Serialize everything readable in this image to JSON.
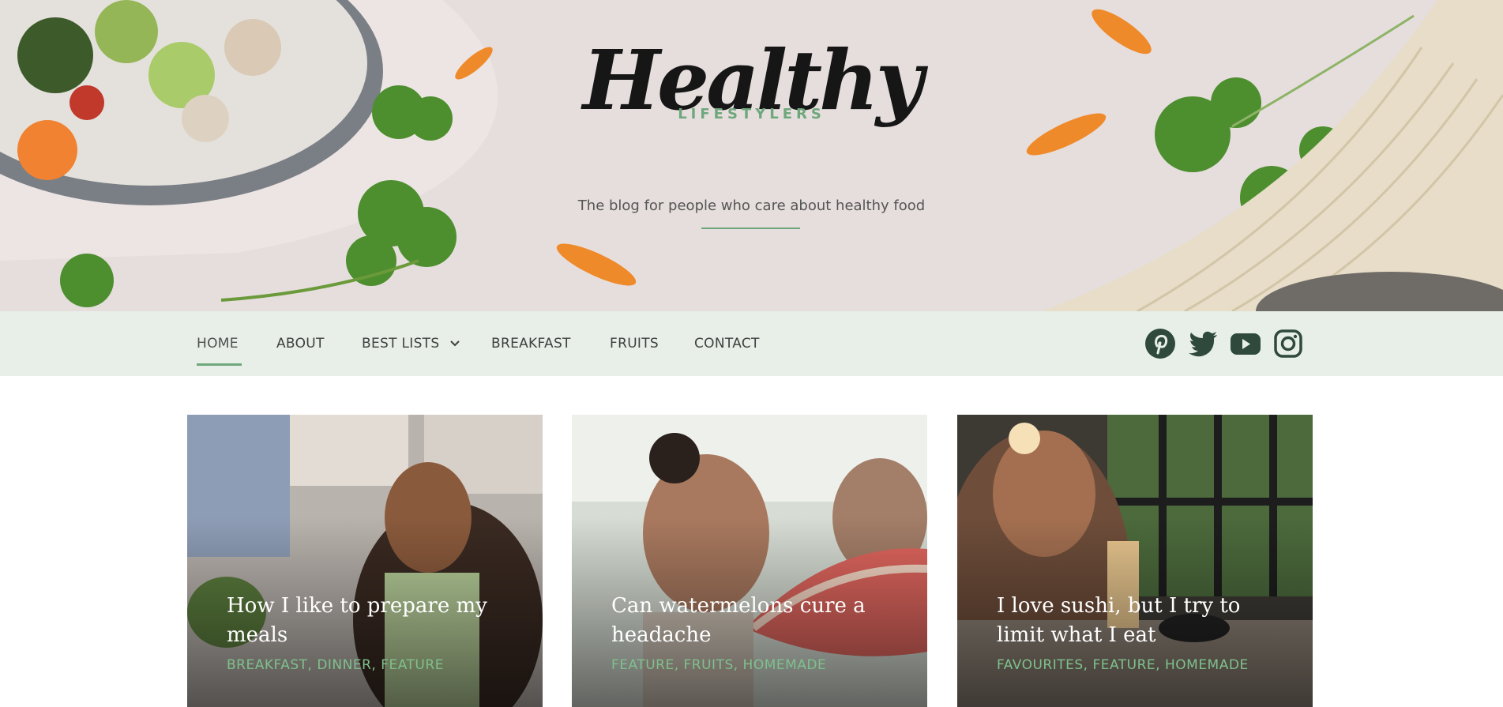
{
  "site": {
    "logo_main": "Healthy",
    "logo_sub": "LIFESTYLERS",
    "tagline": "The blog for people who care about healthy food"
  },
  "nav": {
    "items": [
      {
        "label": "HOME"
      },
      {
        "label": "ABOUT"
      },
      {
        "label": "BEST LISTS"
      },
      {
        "label": "BREAKFAST"
      },
      {
        "label": "FRUITS"
      },
      {
        "label": "CONTACT"
      }
    ],
    "active": "HOME"
  },
  "social": [
    {
      "icon": "pinterest-icon"
    },
    {
      "icon": "twitter-icon"
    },
    {
      "icon": "youtube-icon"
    },
    {
      "icon": "instagram-icon"
    }
  ],
  "posts": [
    {
      "title": "How I like to prepare my meals",
      "categories": "BREAKFAST, DINNER, FEATURE"
    },
    {
      "title": "Can watermelons cure a headache",
      "categories": "FEATURE, FRUITS, HOMEMADE"
    },
    {
      "title": "I love sushi, but I try to limit what I eat",
      "categories": "FAVOURITES, FEATURE, HOMEMADE"
    }
  ],
  "colors": {
    "accent": "#6fa77d",
    "nav_bg": "#e7efe8",
    "icon": "#2f4a3c",
    "category_text": "#7fc08c"
  }
}
